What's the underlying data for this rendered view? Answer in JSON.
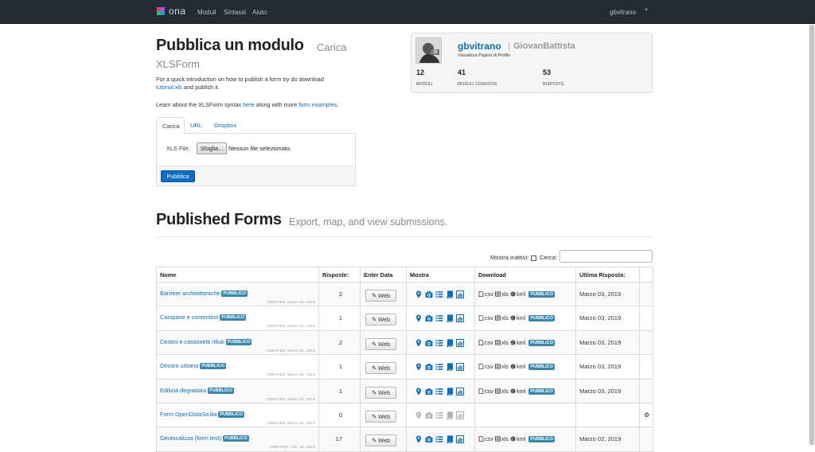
{
  "nav": {
    "logo_text": "ona",
    "links": [
      "Moduli",
      "Sintassi",
      "Aiuto"
    ],
    "user": "gbvitrano"
  },
  "publish": {
    "title": "Pubblica un modulo",
    "subtitle_a": "Carica",
    "subtitle_b": "XLSForm",
    "intro_line1": "For a quick introduction on how to publish a form try do download",
    "intro_link1": "tutorial.xls",
    "intro_line2": "and publish it.",
    "learn_prefix": "Learn about the XLSForm syntax",
    "learn_link1": "here",
    "learn_mid": "along with more",
    "learn_link2": "form examples",
    "learn_end": ".",
    "tabs": [
      "Carica",
      "URL",
      "Dropbox"
    ],
    "xls_label": "XLS File:",
    "browse_label": "Sfoglia...",
    "no_file": "Nessun file selezionato.",
    "publish_button": "Pubblica"
  },
  "profile": {
    "username": "gbvitrano",
    "separator": "|",
    "full_name": "GiovanBattista",
    "view_profile": "Visualizza Pagina di Profilo",
    "stats": [
      {
        "value": "12",
        "label": "MODULI"
      },
      {
        "value": "41",
        "label": "MODULI CONDIVISI"
      },
      {
        "value": "53",
        "label": "RISPOSTE"
      }
    ]
  },
  "forms": {
    "title": "Published Forms",
    "subtitle": "Export, map, and view submissions.",
    "show_inactive_label": "Mostra inattivi:",
    "search_label": "Cerca:",
    "columns": [
      "Nome",
      "Risposte:",
      "Enter Data",
      "Mostra",
      "Download",
      "Ultima Risposta:",
      ""
    ],
    "public_badge": "PUBBLICO",
    "web_label": "Web",
    "download": {
      "csv": "csv",
      "xls": "xls",
      "kml": "kml"
    },
    "rows": [
      {
        "name": "Barriere architettoniche",
        "created": "CREATED: Marzo 03, 2019",
        "responses": "2",
        "last": "Marzo 03, 2019",
        "active_icons": true,
        "has_download": true,
        "gear": false
      },
      {
        "name": "Campane e contenitori",
        "created": "CREATED: Marzo 03, 2019",
        "responses": "1",
        "last": "Marzo 03, 2019",
        "active_icons": true,
        "has_download": true,
        "gear": false
      },
      {
        "name": "Cestini e cassonetti rifiuti",
        "created": "CREATED: Marzo 03, 2019",
        "responses": "2",
        "last": "Marzo 03, 2019",
        "active_icons": true,
        "has_download": true,
        "gear": false
      },
      {
        "name": "Decoro urbano",
        "created": "CREATED: Marzo 03, 2019",
        "responses": "1",
        "last": "Marzo 03, 2019",
        "active_icons": true,
        "has_download": true,
        "gear": false
      },
      {
        "name": "Edilizia degradata",
        "created": "CREATED: Marzo 03, 2019",
        "responses": "1",
        "last": "Marzo 03, 2019",
        "active_icons": true,
        "has_download": true,
        "gear": false
      },
      {
        "name": "Form OpenDataSicilia",
        "created": "CREATED: Marzo 05, 2019",
        "responses": "0",
        "last": "",
        "active_icons": false,
        "has_download": false,
        "gear": true
      },
      {
        "name": "Geolocalizza (form test)",
        "created": "CREATED: Feb. 26, 2019",
        "responses": "17",
        "last": "Marzo 02, 2019",
        "active_icons": true,
        "has_download": true,
        "gear": false
      }
    ]
  },
  "colors": {
    "nav_bg": "#232b35",
    "link": "#0e6fb8",
    "badge": "#3a87ad",
    "primary_button": "#0f6cc2"
  }
}
